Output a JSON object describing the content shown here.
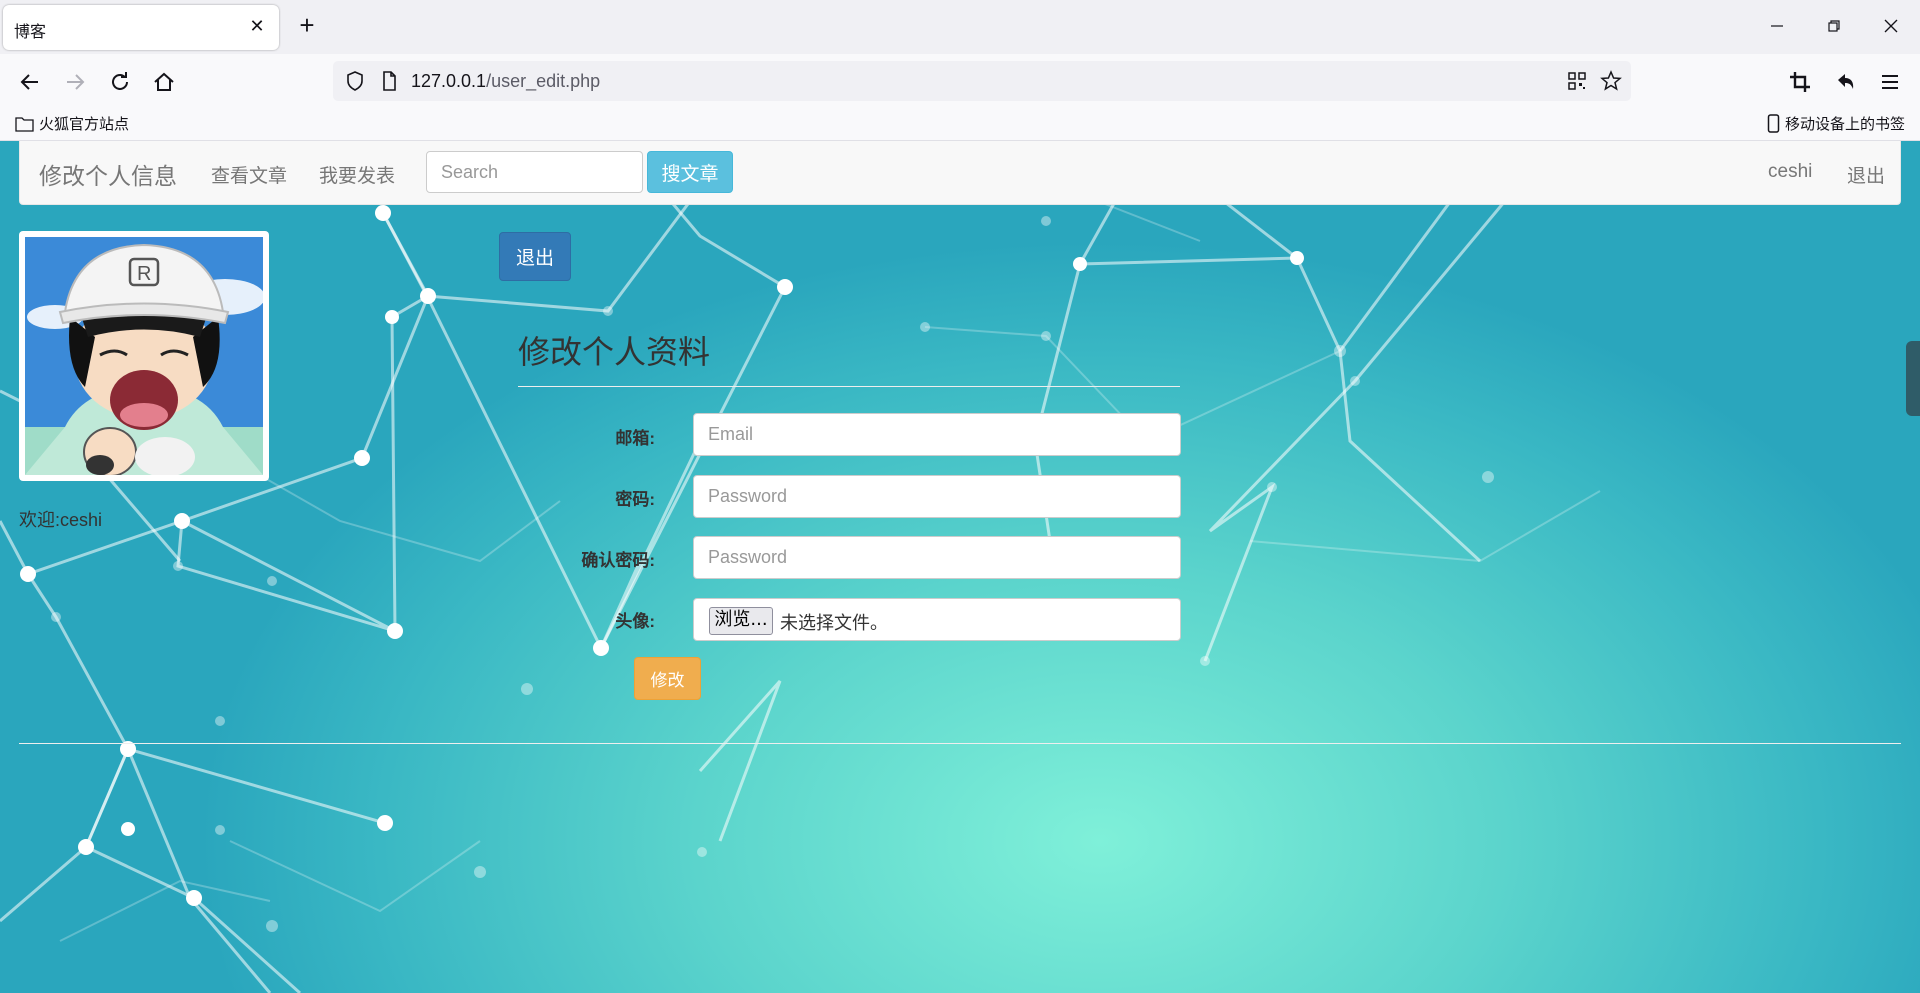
{
  "browser": {
    "tab_title": "博客",
    "url_host": "127.0.0.1",
    "url_path": "/user_edit.php",
    "bookmarks": {
      "left": "火狐官方站点",
      "right": "移动设备上的书签"
    }
  },
  "site": {
    "brand": "修改个人信息",
    "nav_links": [
      "查看文章",
      "我要发表"
    ],
    "search_placeholder": "Search",
    "search_button": "搜文章",
    "user_name": "ceshi",
    "logout_link": "退出"
  },
  "sidebar": {
    "welcome": "欢迎:ceshi"
  },
  "main": {
    "logout_button": "退出",
    "form_title": "修改个人资料",
    "fields": {
      "email_label": "邮箱:",
      "email_placeholder": "Email",
      "password_label": "密码:",
      "password_placeholder": "Password",
      "confirm_label": "确认密码:",
      "confirm_placeholder": "Password",
      "avatar_label": "头像:",
      "file_button": "浏览...",
      "file_status": "未选择文件。"
    },
    "submit_button": "修改"
  },
  "colors": {
    "primary": "#337ab7",
    "info": "#5bc0de",
    "warning": "#f0ad4e",
    "background_teal": "#5bd4cc"
  },
  "icons": [
    "back-icon",
    "forward-icon",
    "reload-icon",
    "home-icon",
    "shield-icon",
    "page-icon",
    "qr-code-icon",
    "star-icon",
    "crop-icon",
    "undo-icon",
    "menu-icon",
    "folder-icon",
    "mobile-icon"
  ]
}
